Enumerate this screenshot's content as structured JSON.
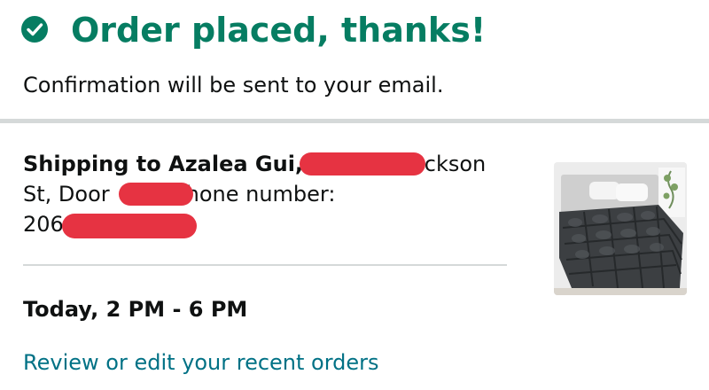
{
  "header": {
    "title": "Order placed, thanks!",
    "subtitle": "Confirmation will be sent to your email.",
    "accent_color": "#067d62",
    "icon": "check-circle-icon"
  },
  "shipping": {
    "line1_bold": "Shipping to Azalea Gui,",
    "line1_tail": "ackson",
    "line2_head": "St, Door",
    "line2_tail": "hone number:",
    "line3_head": "206",
    "redaction_color": "#e63342"
  },
  "product": {
    "image_icon": "comforter-product-image"
  },
  "delivery": {
    "window": "Today, 2 PM - 6 PM"
  },
  "links": {
    "review_orders": "Review or edit your recent orders",
    "link_color": "#007185"
  }
}
